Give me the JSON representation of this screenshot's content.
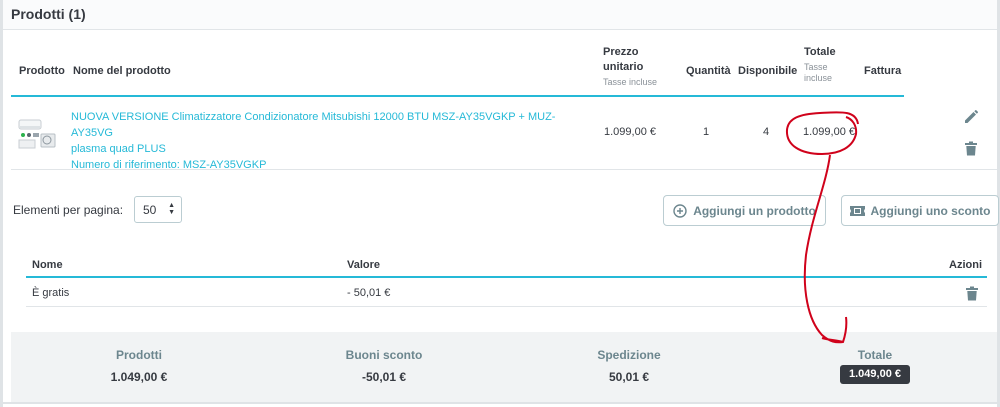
{
  "panel": {
    "title": "Prodotti (1)"
  },
  "table_headers": {
    "product": "Prodotto",
    "product_name": "Nome del prodotto",
    "unit_price_line1": "Prezzo",
    "unit_price_line2": "unitario",
    "unit_price_sub": "Tasse incluse",
    "quantity": "Quantità",
    "available": "Disponibile",
    "total": "Totale",
    "total_sub_line1": "Tasse",
    "total_sub_line2": "incluse",
    "invoice": "Fattura"
  },
  "product_row": {
    "name_line1": "NUOVA VERSIONE Climatizzatore Condizionatore Mitsubishi 12000 BTU MSZ-AY35VGKP + MUZ-AY35VG",
    "name_line2": "plasma quad PLUS",
    "reference": "Numero di riferimento: MSZ-AY35VGKP",
    "unit_price": "1.099,00 €",
    "quantity": "1",
    "available": "4",
    "total": "1.099,00 €"
  },
  "pagination": {
    "label": "Elementi per pagina:",
    "selected": "50"
  },
  "actions": {
    "add_product": "Aggiungi un prodotto",
    "add_discount": "Aggiungi uno sconto"
  },
  "discount_table": {
    "headers": {
      "name": "Nome",
      "value": "Valore",
      "actions": "Azioni"
    },
    "rows": [
      {
        "name": "È gratis",
        "value": "- 50,01 €"
      }
    ]
  },
  "summary": {
    "products_label": "Prodotti",
    "products_value": "1.049,00 €",
    "discounts_label": "Buoni sconto",
    "discounts_value": "-50,01 €",
    "shipping_label": "Spedizione",
    "shipping_value": "50,01 €",
    "total_label": "Totale",
    "total_value": "1.049,00 €"
  },
  "colors": {
    "accent": "#25b9d7",
    "annotation": "#d0021b",
    "text": "#363a41",
    "muted": "#6c868e",
    "badge": "#363a41"
  }
}
